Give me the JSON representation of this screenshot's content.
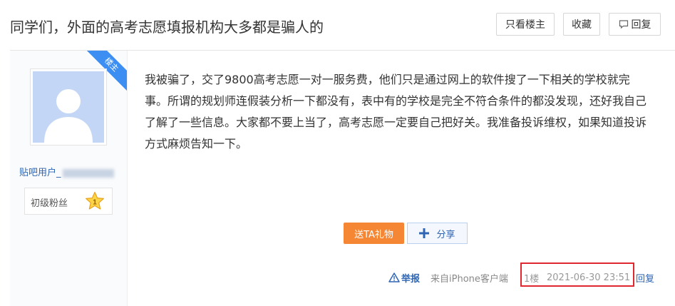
{
  "header": {
    "title": "同学们，外面的高考志愿填报机构大多都是骗人的",
    "only_op_label": "只看楼主",
    "collect_label": "收藏",
    "reply_label": "回复"
  },
  "post": {
    "op_badge": "楼主",
    "author": {
      "name_prefix": "贴吧用户_",
      "level_name": "初级粉丝",
      "level": "1"
    },
    "content": "我被骗了，交了9800高考志愿一对一服务费，他们只是通过网上的软件搜了一下相关的学校就完事。所谓的规划师连假装分析一下都没有，表中有的学校是完全不符合条件的都没发现，还好我自己了解了一些信息。大家都不要上当了，高考志愿一定要自己把好关。我准备投诉维权，如果知道投诉方式麻烦告知一下。",
    "gift_label": "送TA礼物",
    "share_label": "分享",
    "tail": {
      "report_label": "举报",
      "client": "来自iPhone客户端",
      "floor": "1楼",
      "time": "2021-06-30 23:51",
      "reply_label": "回复"
    }
  },
  "colors": {
    "link": "#2d64b3",
    "accent": "#f58634",
    "highlight_border": "#e0272f",
    "op_badge": "#3d8ef3"
  }
}
